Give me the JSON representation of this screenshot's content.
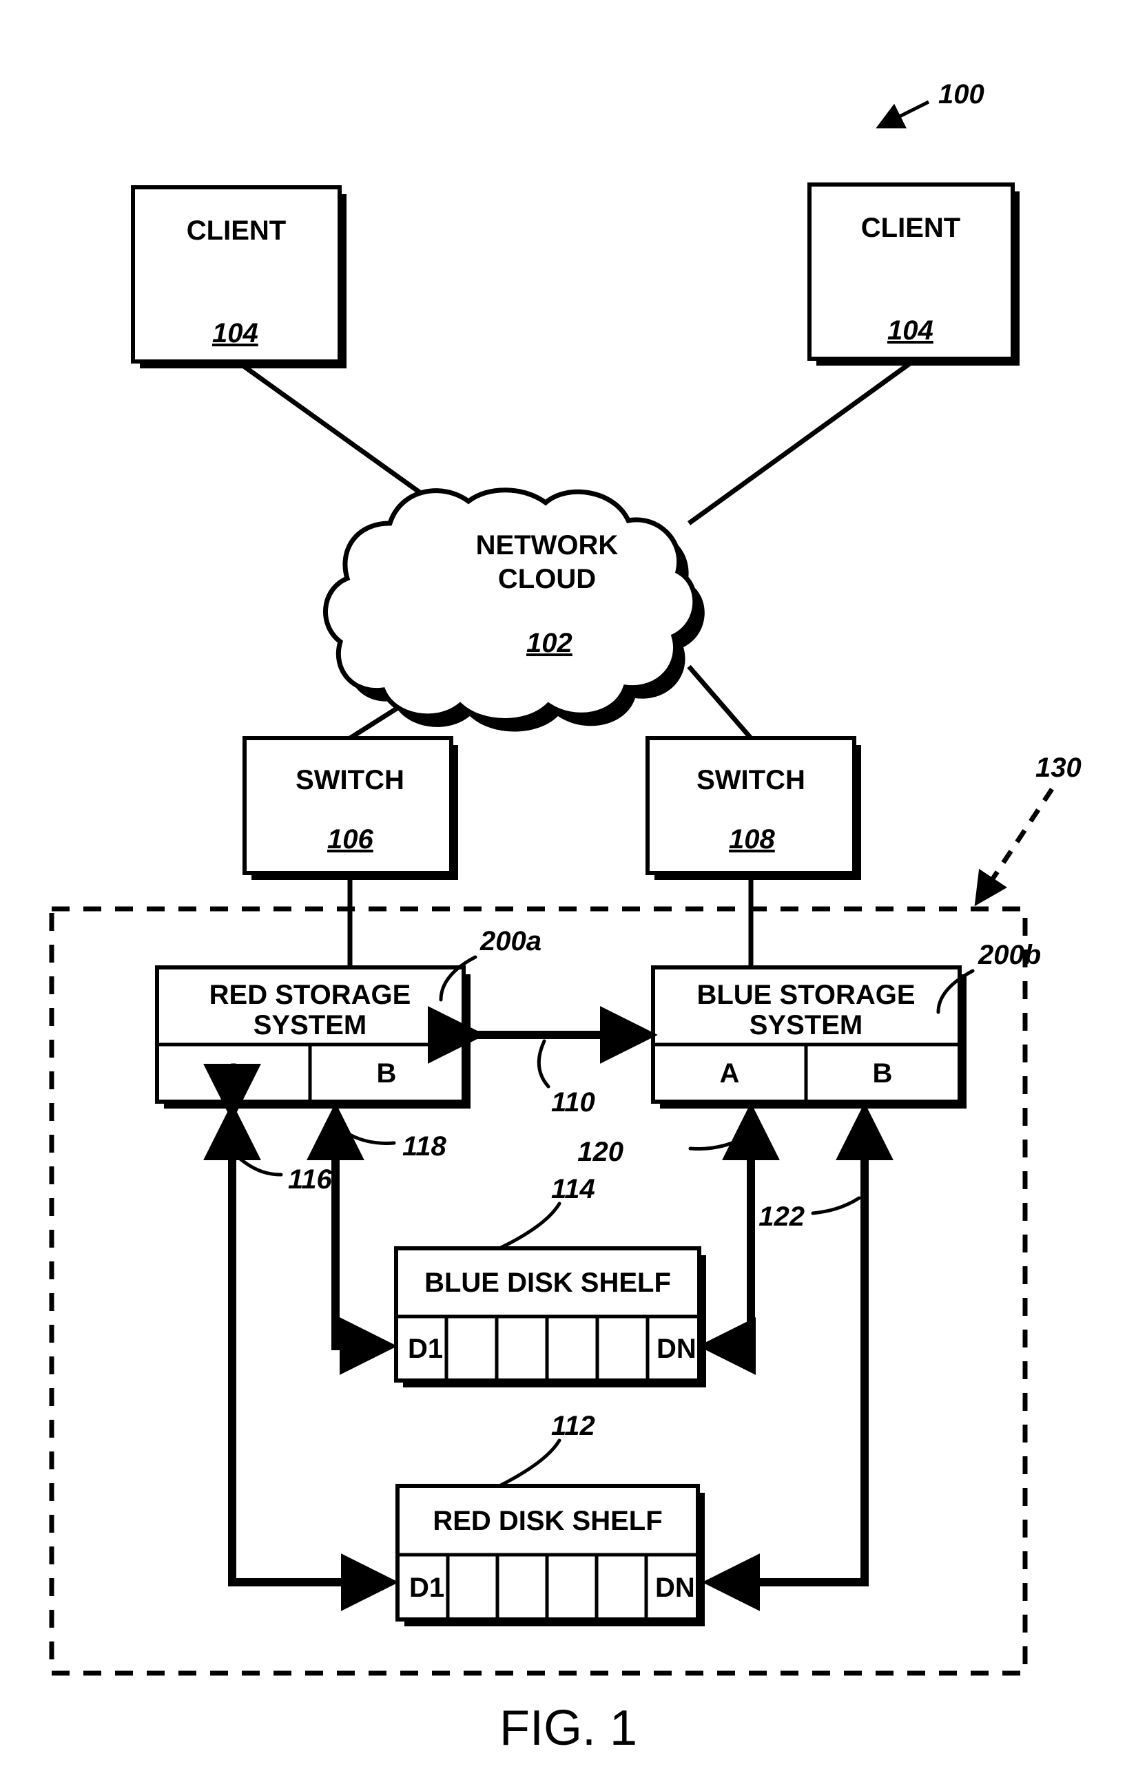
{
  "figure": {
    "caption": "FIG. 1",
    "system_ref": "100"
  },
  "clients": [
    {
      "title": "CLIENT",
      "ref": "104"
    },
    {
      "title": "CLIENT",
      "ref": "104"
    }
  ],
  "network": {
    "title_line1": "NETWORK",
    "title_line2": "CLOUD",
    "ref": "102"
  },
  "switches": [
    {
      "title": "SWITCH",
      "ref": "106"
    },
    {
      "title": "SWITCH",
      "ref": "108"
    }
  ],
  "cluster": {
    "ref": "130"
  },
  "storage_systems": [
    {
      "title_line1": "RED STORAGE",
      "title_line2": "SYSTEM",
      "ref": "200a",
      "ports": [
        "A",
        "B"
      ]
    },
    {
      "title_line1": "BLUE STORAGE",
      "title_line2": "SYSTEM",
      "ref": "200b",
      "ports": [
        "A",
        "B"
      ]
    }
  ],
  "interconnect": {
    "ref": "110"
  },
  "disk_shelves": [
    {
      "title": "BLUE DISK SHELF",
      "ref": "114",
      "first_disk": "D1",
      "last_disk": "DN",
      "disk_count": 6
    },
    {
      "title": "RED DISK SHELF",
      "ref": "112",
      "first_disk": "D1",
      "last_disk": "DN",
      "disk_count": 6
    }
  ],
  "connection_refs": {
    "red_a_to_red_shelf": "116",
    "red_b_to_blue_shelf": "118",
    "blue_a_to_blue_shelf": "120",
    "blue_b_to_red_shelf": "122"
  }
}
